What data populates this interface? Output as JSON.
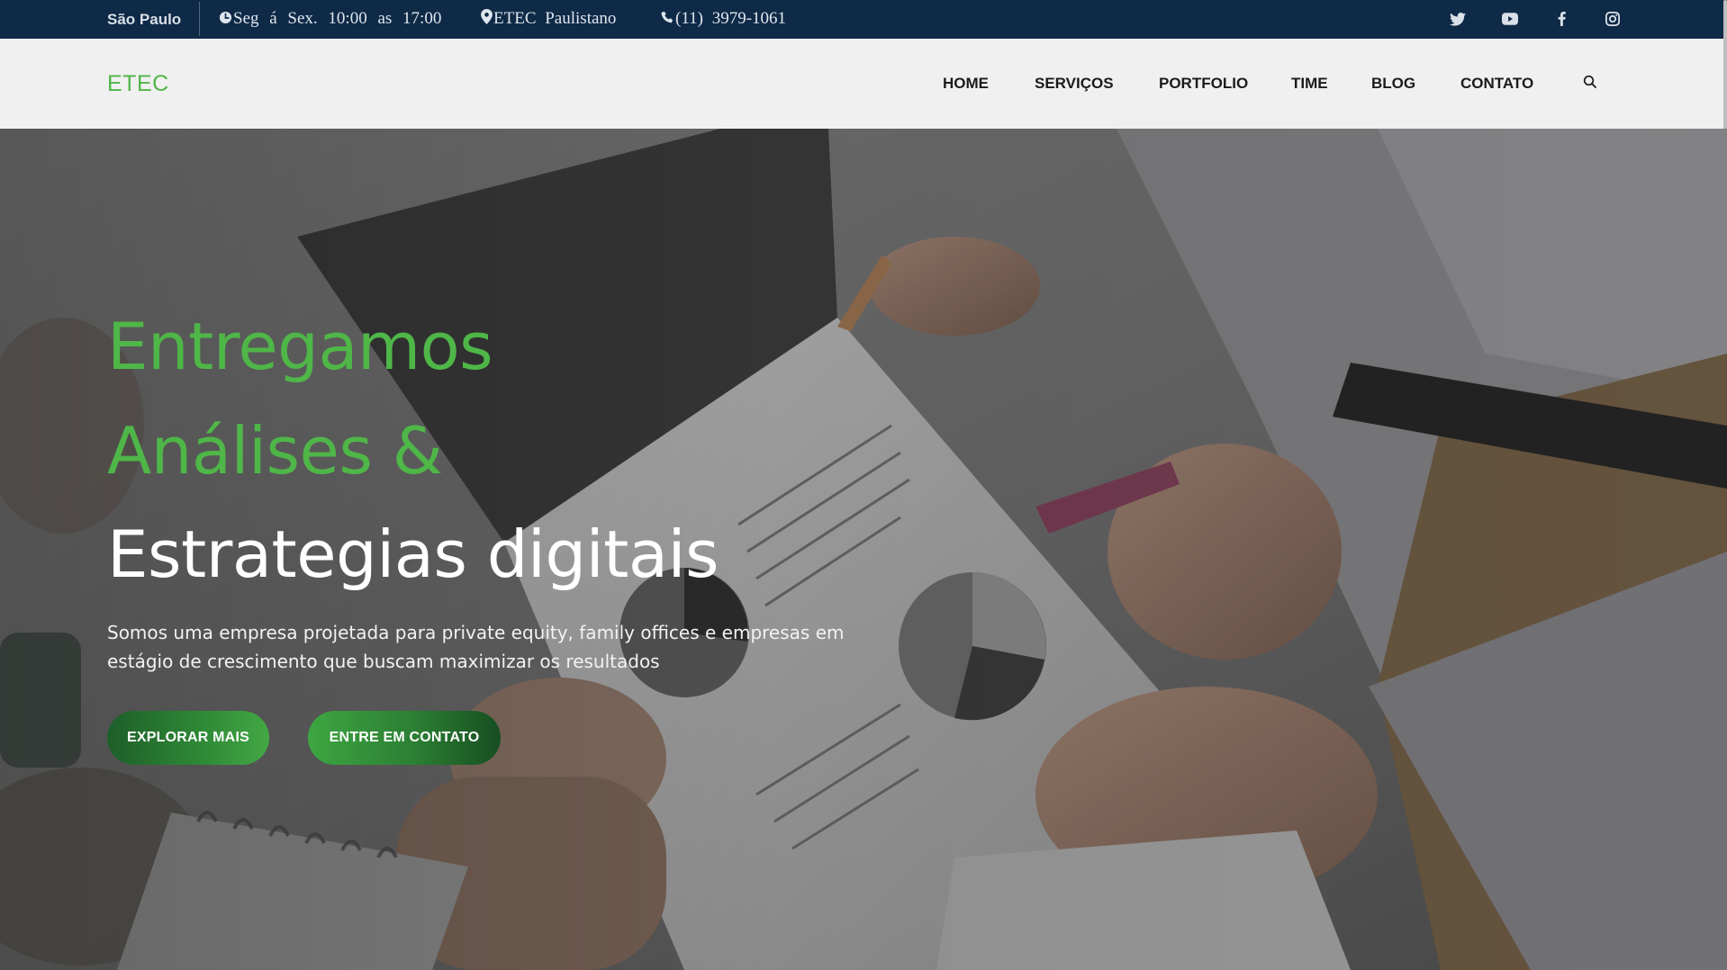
{
  "topbar": {
    "city": "São Paulo",
    "hours": "Seg á Sex. 10:00 as 17:00",
    "address": "ETEC Paulistano",
    "phone": "(11) 3979-1061",
    "icons": [
      "clock-icon",
      "map-pin-icon",
      "phone-icon"
    ],
    "social": [
      "twitter-icon",
      "youtube-icon",
      "facebook-icon",
      "instagram-icon"
    ]
  },
  "nav": {
    "brand": "ETEC",
    "items": [
      "HOME",
      "SERVIÇOS",
      "PORTFOLIO",
      "TIME",
      "BLOG",
      "CONTATO"
    ],
    "search_icon": "search-icon"
  },
  "hero": {
    "headline_line1": "Entregamos",
    "headline_line2": "Análises &",
    "headline_line3": "Estrategias digitais",
    "lead": "Somos uma empresa projetada para private equity, family offices e empresas em estágio de crescimento que buscam maximizar os resultados",
    "button_explore": "EXPLORAR MAIS",
    "button_contact": "ENTRE EM CONTATO"
  },
  "colors": {
    "topbar_bg": "#0f2a47",
    "navbar_bg": "#f0f0f0",
    "accent_green": "#4fb648",
    "button_dark_green": "#1e5e2a"
  }
}
